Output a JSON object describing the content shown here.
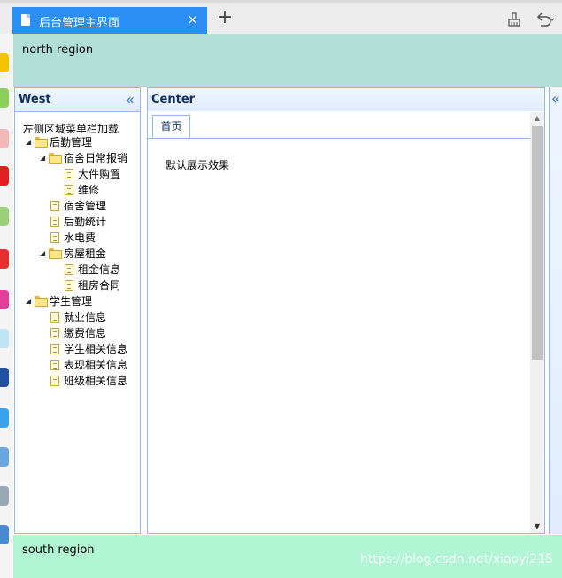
{
  "browser": {
    "tab_title": "后台管理主界面",
    "tab_close": "×",
    "new_tab": "+"
  },
  "north": {
    "text": "north region"
  },
  "west": {
    "title": "West",
    "collapse_icon": "«",
    "description": "左侧区域菜单栏加载",
    "tree": [
      {
        "label": "后勤管理",
        "type": "folder",
        "level": 0,
        "expanded": true
      },
      {
        "label": "宿舍日常报销",
        "type": "folder",
        "level": 1,
        "expanded": true
      },
      {
        "label": "大件购置",
        "type": "file",
        "level": 2
      },
      {
        "label": "维修",
        "type": "file",
        "level": 2
      },
      {
        "label": "宿舍管理",
        "type": "file",
        "level": 1
      },
      {
        "label": "后勤统计",
        "type": "file",
        "level": 1
      },
      {
        "label": "水电费",
        "type": "file",
        "level": 1
      },
      {
        "label": "房屋租金",
        "type": "folder",
        "level": 1,
        "expanded": true
      },
      {
        "label": "租金信息",
        "type": "file",
        "level": 2
      },
      {
        "label": "租房合同",
        "type": "file",
        "level": 2
      },
      {
        "label": "学生管理",
        "type": "folder",
        "level": 0,
        "expanded": true
      },
      {
        "label": "就业信息",
        "type": "file",
        "level": 1
      },
      {
        "label": "缴费信息",
        "type": "file",
        "level": 1
      },
      {
        "label": "学生相关信息",
        "type": "file",
        "level": 1
      },
      {
        "label": "表现相关信息",
        "type": "file",
        "level": 1
      },
      {
        "label": "班级相关信息",
        "type": "file",
        "level": 1
      }
    ]
  },
  "center": {
    "title": "Center",
    "tabs": [
      {
        "label": "首页"
      }
    ],
    "content": "默认展示效果"
  },
  "east": {
    "expand_icon": "«"
  },
  "south": {
    "text": "south region",
    "watermark": "https://blog.csdn.net/xiaoyi215"
  }
}
